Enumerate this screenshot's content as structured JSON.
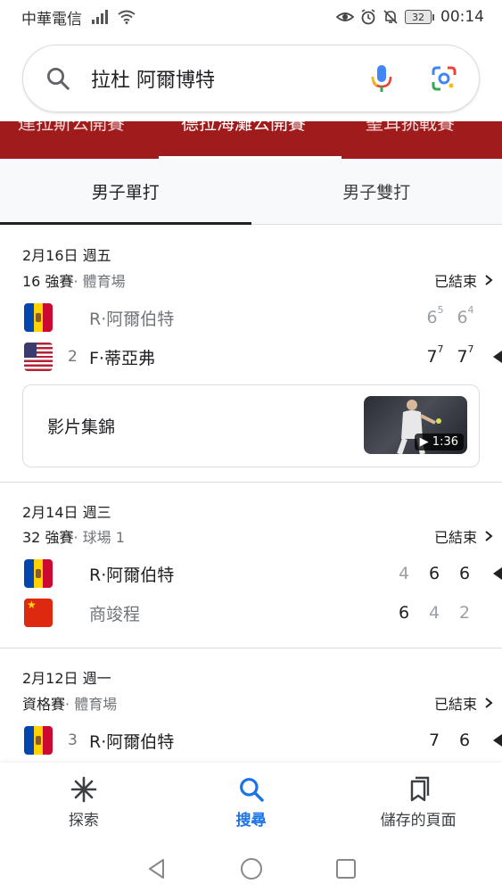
{
  "status_bar": {
    "carrier": "中華電信",
    "battery": "32",
    "time": "00:14"
  },
  "search": {
    "query": "拉杜 阿爾博特"
  },
  "tournament_tabs": [
    "達拉斯公開賽",
    "德拉海灘公開賽",
    "聖耳挑戰賽"
  ],
  "draw_tabs": {
    "singles": "男子單打",
    "doubles": "男子雙打"
  },
  "matches": [
    {
      "date": "2月16日 週五",
      "round": "16 強賽",
      "venue": "· 體育場",
      "status": "已結束",
      "players": [
        {
          "seed": "",
          "name": "R·阿爾伯特",
          "flag": "moldova",
          "scores": [
            "6",
            "6"
          ],
          "tiebreaks": [
            "5",
            "4"
          ],
          "winner": false
        },
        {
          "seed": "2",
          "name": "F·蒂亞弗",
          "flag": "usa",
          "scores": [
            "7",
            "7"
          ],
          "tiebreaks": [
            "7",
            "7"
          ],
          "winner": true
        }
      ],
      "video": {
        "label": "影片集錦",
        "duration": "1:36"
      }
    },
    {
      "date": "2月14日 週三",
      "round": "32 強賽",
      "venue": "· 球場 1",
      "status": "已結束",
      "players": [
        {
          "seed": "",
          "name": "R·阿爾伯特",
          "flag": "moldova",
          "scores": [
            "4",
            "6",
            "6"
          ],
          "winner": true
        },
        {
          "seed": "",
          "name": "商竣程",
          "flag": "china",
          "scores": [
            "6",
            "4",
            "2"
          ],
          "winner": false
        }
      ]
    },
    {
      "date": "2月12日 週一",
      "round": "資格賽",
      "venue": "· 體育場",
      "status": "已結束",
      "players": [
        {
          "seed": "3",
          "name": "R·阿爾伯特",
          "flag": "moldova",
          "scores": [
            "7",
            "6"
          ],
          "winner": true
        }
      ]
    }
  ],
  "bottom_nav": {
    "explore": "探索",
    "search": "搜尋",
    "saved": "儲存的頁面"
  },
  "colors": {
    "accent": "#1a73e8",
    "tournament_strip": "#a01c1c"
  }
}
